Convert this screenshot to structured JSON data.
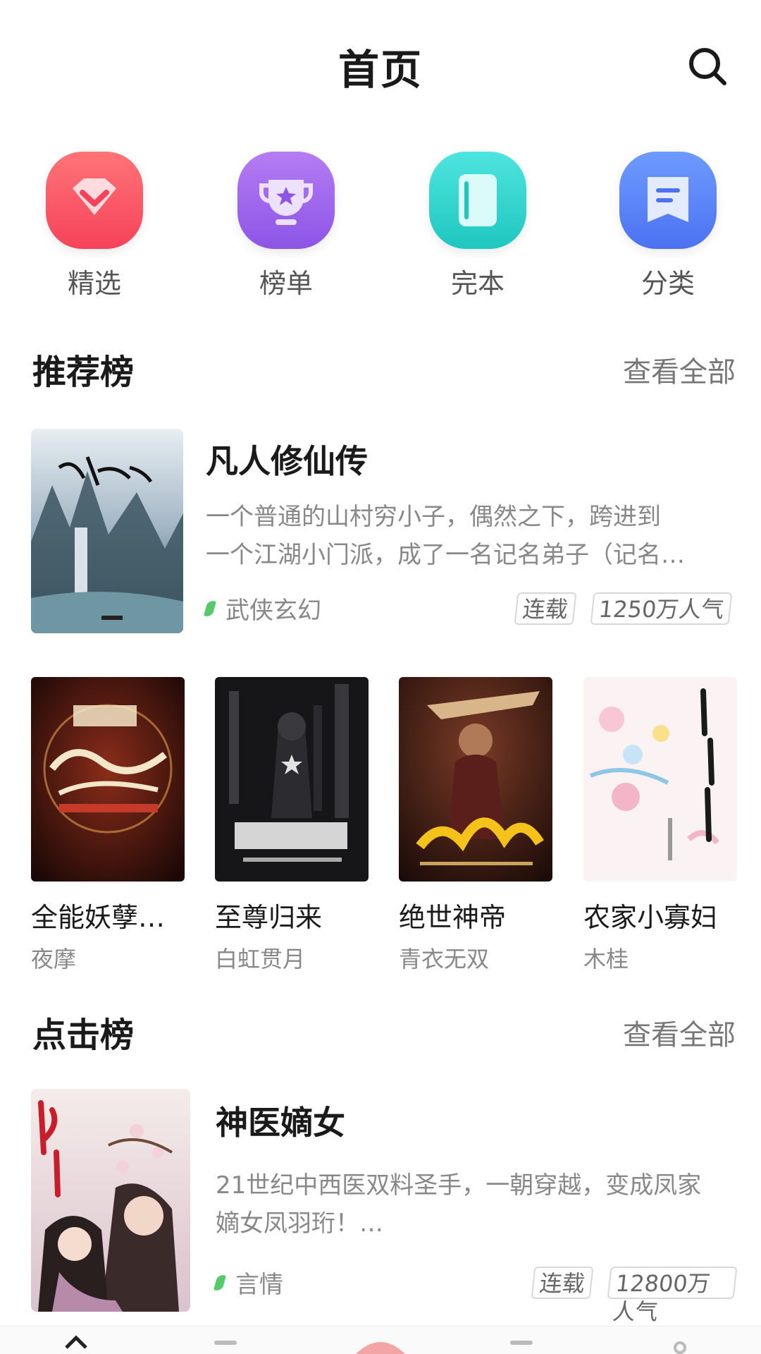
{
  "header": {
    "title": "首页"
  },
  "quick_nav": [
    {
      "label": "精选",
      "icon": "diamond-icon"
    },
    {
      "label": "榜单",
      "icon": "trophy-icon"
    },
    {
      "label": "完本",
      "icon": "book-icon"
    },
    {
      "label": "分类",
      "icon": "category-icon"
    }
  ],
  "recommend": {
    "title": "推荐榜",
    "more": "查看全部",
    "feature": {
      "name": "凡人修仙传",
      "desc_line1": "一个普通的山村穷小子，偶然之下，跨进到",
      "desc_line2": "一个江湖小门派，成了一名记名弟子（记名…",
      "genre": "武侠玄幻",
      "status": "连载",
      "popularity": "1250万人气"
    },
    "books": [
      {
        "name": "全能妖孽…",
        "author": "夜摩"
      },
      {
        "name": "至尊归来",
        "author": "白虹贯月"
      },
      {
        "name": "绝世神帝",
        "author": "青衣无双"
      },
      {
        "name": "农家小寡妇",
        "author": "木桂"
      }
    ]
  },
  "clicks": {
    "title": "点击榜",
    "more": "查看全部",
    "feature": {
      "name": "神医嫡女",
      "desc_line1": "21世纪中西医双料圣手，一朝穿越，变成凤家",
      "desc_line2": "嫡女凤羽珩！…",
      "genre": "言情",
      "status": "连载",
      "popularity": "12800万人气"
    }
  }
}
